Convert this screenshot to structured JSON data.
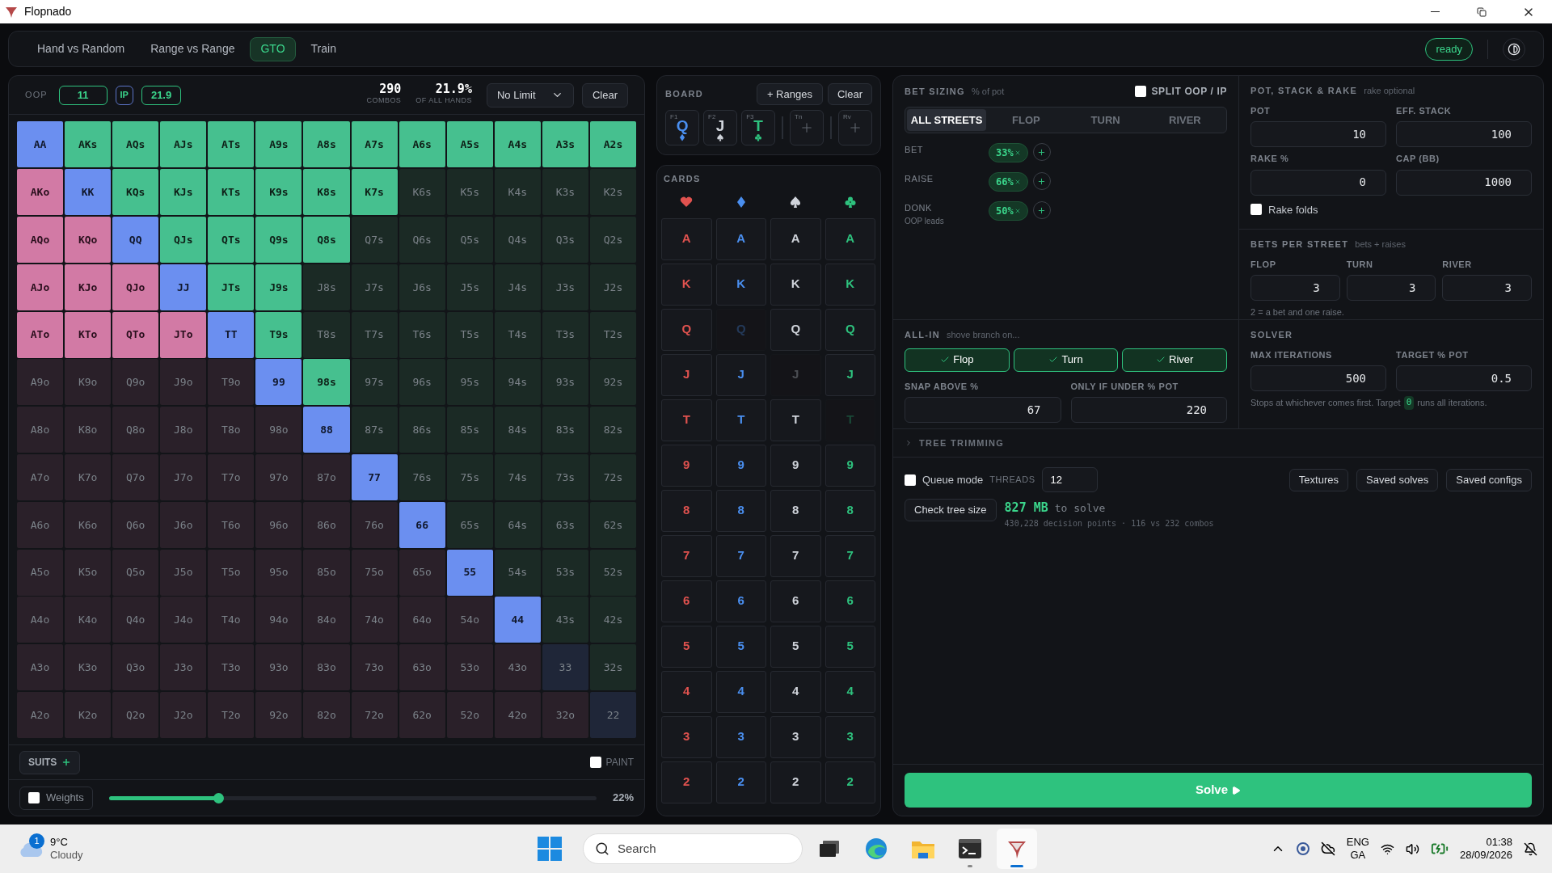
{
  "window": {
    "title": "Flopnado"
  },
  "nav": {
    "tabs": [
      {
        "label": "Hand vs Random",
        "selected": false
      },
      {
        "label": "Range vs Range",
        "selected": false
      },
      {
        "label": "GTO",
        "selected": true
      },
      {
        "label": "Train",
        "selected": false
      }
    ],
    "status": "ready"
  },
  "range": {
    "player_label": "OOP",
    "oop_value": "11",
    "ip_label": "IP",
    "ip_value": "21.9",
    "combos": "290",
    "combos_label": "COMBOS",
    "percent": "21.9%",
    "percent_label": "OF ALL HANDS",
    "limit_select": "No Limit",
    "clear": "Clear",
    "rows": [
      [
        {
          "label": "AA",
          "selected": true
        },
        {
          "label": "AKs",
          "selected": true
        },
        {
          "label": "AQs",
          "selected": true
        },
        {
          "label": "AJs",
          "selected": true
        },
        {
          "label": "ATs",
          "selected": true
        },
        {
          "label": "A9s",
          "selected": true
        },
        {
          "label": "A8s",
          "selected": true
        },
        {
          "label": "A7s",
          "selected": true
        },
        {
          "label": "A6s",
          "selected": true
        },
        {
          "label": "A5s",
          "selected": true
        },
        {
          "label": "A4s",
          "selected": true
        },
        {
          "label": "A3s",
          "selected": true
        },
        {
          "label": "A2s",
          "selected": true
        }
      ],
      [
        {
          "label": "AKo",
          "selected": true
        },
        {
          "label": "KK",
          "selected": true
        },
        {
          "label": "KQs",
          "selected": true
        },
        {
          "label": "KJs",
          "selected": true
        },
        {
          "label": "KTs",
          "selected": true
        },
        {
          "label": "K9s",
          "selected": true
        },
        {
          "label": "K8s",
          "selected": true
        },
        {
          "label": "K7s",
          "selected": true
        },
        {
          "label": "K6s",
          "selected": false
        },
        {
          "label": "K5s",
          "selected": false
        },
        {
          "label": "K4s",
          "selected": false
        },
        {
          "label": "K3s",
          "selected": false
        },
        {
          "label": "K2s",
          "selected": false
        }
      ],
      [
        {
          "label": "AQo",
          "selected": true
        },
        {
          "label": "KQo",
          "selected": true
        },
        {
          "label": "QQ",
          "selected": true
        },
        {
          "label": "QJs",
          "selected": true
        },
        {
          "label": "QTs",
          "selected": true
        },
        {
          "label": "Q9s",
          "selected": true
        },
        {
          "label": "Q8s",
          "selected": true
        },
        {
          "label": "Q7s",
          "selected": false
        },
        {
          "label": "Q6s",
          "selected": false
        },
        {
          "label": "Q5s",
          "selected": false
        },
        {
          "label": "Q4s",
          "selected": false
        },
        {
          "label": "Q3s",
          "selected": false
        },
        {
          "label": "Q2s",
          "selected": false
        }
      ],
      [
        {
          "label": "AJo",
          "selected": true
        },
        {
          "label": "KJo",
          "selected": true
        },
        {
          "label": "QJo",
          "selected": true
        },
        {
          "label": "JJ",
          "selected": true
        },
        {
          "label": "JTs",
          "selected": true
        },
        {
          "label": "J9s",
          "selected": true
        },
        {
          "label": "J8s",
          "selected": false
        },
        {
          "label": "J7s",
          "selected": false
        },
        {
          "label": "J6s",
          "selected": false
        },
        {
          "label": "J5s",
          "selected": false
        },
        {
          "label": "J4s",
          "selected": false
        },
        {
          "label": "J3s",
          "selected": false
        },
        {
          "label": "J2s",
          "selected": false
        }
      ],
      [
        {
          "label": "ATo",
          "selected": true
        },
        {
          "label": "KTo",
          "selected": true
        },
        {
          "label": "QTo",
          "selected": true
        },
        {
          "label": "JTo",
          "selected": true
        },
        {
          "label": "TT",
          "selected": true
        },
        {
          "label": "T9s",
          "selected": true
        },
        {
          "label": "T8s",
          "selected": false
        },
        {
          "label": "T7s",
          "selected": false
        },
        {
          "label": "T6s",
          "selected": false
        },
        {
          "label": "T5s",
          "selected": false
        },
        {
          "label": "T4s",
          "selected": false
        },
        {
          "label": "T3s",
          "selected": false
        },
        {
          "label": "T2s",
          "selected": false
        }
      ],
      [
        {
          "label": "A9o",
          "selected": false
        },
        {
          "label": "K9o",
          "selected": false
        },
        {
          "label": "Q9o",
          "selected": false
        },
        {
          "label": "J9o",
          "selected": false
        },
        {
          "label": "T9o",
          "selected": false
        },
        {
          "label": "99",
          "selected": true
        },
        {
          "label": "98s",
          "selected": true
        },
        {
          "label": "97s",
          "selected": false
        },
        {
          "label": "96s",
          "selected": false
        },
        {
          "label": "95s",
          "selected": false
        },
        {
          "label": "94s",
          "selected": false
        },
        {
          "label": "93s",
          "selected": false
        },
        {
          "label": "92s",
          "selected": false
        }
      ],
      [
        {
          "label": "A8o",
          "selected": false
        },
        {
          "label": "K8o",
          "selected": false
        },
        {
          "label": "Q8o",
          "selected": false
        },
        {
          "label": "J8o",
          "selected": false
        },
        {
          "label": "T8o",
          "selected": false
        },
        {
          "label": "98o",
          "selected": false
        },
        {
          "label": "88",
          "selected": true
        },
        {
          "label": "87s",
          "selected": false
        },
        {
          "label": "86s",
          "selected": false
        },
        {
          "label": "85s",
          "selected": false
        },
        {
          "label": "84s",
          "selected": false
        },
        {
          "label": "83s",
          "selected": false
        },
        {
          "label": "82s",
          "selected": false
        }
      ],
      [
        {
          "label": "A7o",
          "selected": false
        },
        {
          "label": "K7o",
          "selected": false
        },
        {
          "label": "Q7o",
          "selected": false
        },
        {
          "label": "J7o",
          "selected": false
        },
        {
          "label": "T7o",
          "selected": false
        },
        {
          "label": "97o",
          "selected": false
        },
        {
          "label": "87o",
          "selected": false
        },
        {
          "label": "77",
          "selected": true
        },
        {
          "label": "76s",
          "selected": false
        },
        {
          "label": "75s",
          "selected": false
        },
        {
          "label": "74s",
          "selected": false
        },
        {
          "label": "73s",
          "selected": false
        },
        {
          "label": "72s",
          "selected": false
        }
      ],
      [
        {
          "label": "A6o",
          "selected": false
        },
        {
          "label": "K6o",
          "selected": false
        },
        {
          "label": "Q6o",
          "selected": false
        },
        {
          "label": "J6o",
          "selected": false
        },
        {
          "label": "T6o",
          "selected": false
        },
        {
          "label": "96o",
          "selected": false
        },
        {
          "label": "86o",
          "selected": false
        },
        {
          "label": "76o",
          "selected": false
        },
        {
          "label": "66",
          "selected": true
        },
        {
          "label": "65s",
          "selected": false
        },
        {
          "label": "64s",
          "selected": false
        },
        {
          "label": "63s",
          "selected": false
        },
        {
          "label": "62s",
          "selected": false
        }
      ],
      [
        {
          "label": "A5o",
          "selected": false
        },
        {
          "label": "K5o",
          "selected": false
        },
        {
          "label": "Q5o",
          "selected": false
        },
        {
          "label": "J5o",
          "selected": false
        },
        {
          "label": "T5o",
          "selected": false
        },
        {
          "label": "95o",
          "selected": false
        },
        {
          "label": "85o",
          "selected": false
        },
        {
          "label": "75o",
          "selected": false
        },
        {
          "label": "65o",
          "selected": false
        },
        {
          "label": "55",
          "selected": true
        },
        {
          "label": "54s",
          "selected": false
        },
        {
          "label": "53s",
          "selected": false
        },
        {
          "label": "52s",
          "selected": false
        }
      ],
      [
        {
          "label": "A4o",
          "selected": false
        },
        {
          "label": "K4o",
          "selected": false
        },
        {
          "label": "Q4o",
          "selected": false
        },
        {
          "label": "J4o",
          "selected": false
        },
        {
          "label": "T4o",
          "selected": false
        },
        {
          "label": "94o",
          "selected": false
        },
        {
          "label": "84o",
          "selected": false
        },
        {
          "label": "74o",
          "selected": false
        },
        {
          "label": "64o",
          "selected": false
        },
        {
          "label": "54o",
          "selected": false
        },
        {
          "label": "44",
          "selected": true
        },
        {
          "label": "43s",
          "selected": false
        },
        {
          "label": "42s",
          "selected": false
        }
      ],
      [
        {
          "label": "A3o",
          "selected": false
        },
        {
          "label": "K3o",
          "selected": false
        },
        {
          "label": "Q3o",
          "selected": false
        },
        {
          "label": "J3o",
          "selected": false
        },
        {
          "label": "T3o",
          "selected": false
        },
        {
          "label": "93o",
          "selected": false
        },
        {
          "label": "83o",
          "selected": false
        },
        {
          "label": "73o",
          "selected": false
        },
        {
          "label": "63o",
          "selected": false
        },
        {
          "label": "53o",
          "selected": false
        },
        {
          "label": "43o",
          "selected": false
        },
        {
          "label": "33",
          "selected": false
        },
        {
          "label": "32s",
          "selected": false
        }
      ],
      [
        {
          "label": "A2o",
          "selected": false
        },
        {
          "label": "K2o",
          "selected": false
        },
        {
          "label": "Q2o",
          "selected": false
        },
        {
          "label": "J2o",
          "selected": false
        },
        {
          "label": "T2o",
          "selected": false
        },
        {
          "label": "92o",
          "selected": false
        },
        {
          "label": "82o",
          "selected": false
        },
        {
          "label": "72o",
          "selected": false
        },
        {
          "label": "62o",
          "selected": false
        },
        {
          "label": "52o",
          "selected": false
        },
        {
          "label": "42o",
          "selected": false
        },
        {
          "label": "32o",
          "selected": false
        },
        {
          "label": "22",
          "selected": false
        }
      ]
    ],
    "suits_button": "SUITS",
    "paint": {
      "label": "PAINT",
      "checked": false
    },
    "weights": {
      "label": "Weights",
      "checked": false
    },
    "slider": {
      "level": 0.225,
      "reading": "22%"
    }
  },
  "board": {
    "title": "BOARD",
    "ranges_button": "+ Ranges",
    "clear": "Clear",
    "cards": [
      {
        "slot": "F1",
        "rank": "Q",
        "kind": "diamond"
      },
      {
        "slot": "F2",
        "rank": "J",
        "kind": "spade"
      },
      {
        "slot": "F3",
        "rank": "T",
        "kind": "club"
      },
      {
        "slot": "Tn"
      },
      {
        "slot": "Rv"
      }
    ]
  },
  "cards": {
    "title": "CARDS",
    "columns": [
      {
        "kind": "heart"
      },
      {
        "kind": "diamond"
      },
      {
        "kind": "spade"
      },
      {
        "kind": "club"
      }
    ],
    "rows": [
      [
        {
          "rank": "A",
          "disabled": false
        },
        {
          "rank": "A",
          "disabled": false
        },
        {
          "rank": "A",
          "disabled": false
        },
        {
          "rank": "A",
          "disabled": false
        }
      ],
      [
        {
          "rank": "K",
          "disabled": false
        },
        {
          "rank": "K",
          "disabled": false
        },
        {
          "rank": "K",
          "disabled": false
        },
        {
          "rank": "K",
          "disabled": false
        }
      ],
      [
        {
          "rank": "Q",
          "disabled": false
        },
        {
          "rank": "Q",
          "disabled": true
        },
        {
          "rank": "Q",
          "disabled": false
        },
        {
          "rank": "Q",
          "disabled": false
        }
      ],
      [
        {
          "rank": "J",
          "disabled": false
        },
        {
          "rank": "J",
          "disabled": false
        },
        {
          "rank": "J",
          "disabled": true
        },
        {
          "rank": "J",
          "disabled": false
        }
      ],
      [
        {
          "rank": "T",
          "disabled": false
        },
        {
          "rank": "T",
          "disabled": false
        },
        {
          "rank": "T",
          "disabled": false
        },
        {
          "rank": "T",
          "disabled": true
        }
      ],
      [
        {
          "rank": "9",
          "disabled": false
        },
        {
          "rank": "9",
          "disabled": false
        },
        {
          "rank": "9",
          "disabled": false
        },
        {
          "rank": "9",
          "disabled": false
        }
      ],
      [
        {
          "rank": "8",
          "disabled": false
        },
        {
          "rank": "8",
          "disabled": false
        },
        {
          "rank": "8",
          "disabled": false
        },
        {
          "rank": "8",
          "disabled": false
        }
      ],
      [
        {
          "rank": "7",
          "disabled": false
        },
        {
          "rank": "7",
          "disabled": false
        },
        {
          "rank": "7",
          "disabled": false
        },
        {
          "rank": "7",
          "disabled": false
        }
      ],
      [
        {
          "rank": "6",
          "disabled": false
        },
        {
          "rank": "6",
          "disabled": false
        },
        {
          "rank": "6",
          "disabled": false
        },
        {
          "rank": "6",
          "disabled": false
        }
      ],
      [
        {
          "rank": "5",
          "disabled": false
        },
        {
          "rank": "5",
          "disabled": false
        },
        {
          "rank": "5",
          "disabled": false
        },
        {
          "rank": "5",
          "disabled": false
        }
      ],
      [
        {
          "rank": "4",
          "disabled": false
        },
        {
          "rank": "4",
          "disabled": false
        },
        {
          "rank": "4",
          "disabled": false
        },
        {
          "rank": "4",
          "disabled": false
        }
      ],
      [
        {
          "rank": "3",
          "disabled": false
        },
        {
          "rank": "3",
          "disabled": false
        },
        {
          "rank": "3",
          "disabled": false
        },
        {
          "rank": "3",
          "disabled": false
        }
      ],
      [
        {
          "rank": "2",
          "disabled": false
        },
        {
          "rank": "2",
          "disabled": false
        },
        {
          "rank": "2",
          "disabled": false
        },
        {
          "rank": "2",
          "disabled": false
        }
      ]
    ]
  },
  "bet_sizing": {
    "title": "BET SIZING",
    "subtitle": "% of pot",
    "split": {
      "label": "SPLIT OOP / IP",
      "checked": false
    },
    "tabs": [
      {
        "label": "ALL STREETS",
        "selected": true
      },
      {
        "label": "FLOP",
        "selected": false
      },
      {
        "label": "TURN",
        "selected": false
      },
      {
        "label": "RIVER",
        "selected": false
      }
    ],
    "rows": [
      {
        "label": "BET",
        "sizes": [
          "33%"
        ]
      },
      {
        "label": "RAISE",
        "sizes": [
          "66%"
        ]
      },
      {
        "label": "DONK",
        "note": "OOP leads",
        "sizes": [
          "50%"
        ]
      }
    ]
  },
  "pot_stack": {
    "title": "POT, STACK & RAKE",
    "subtitle": "rake optional",
    "fields": [
      {
        "label": "POT",
        "value": "10"
      },
      {
        "label": "EFF. STACK",
        "value": "100"
      },
      {
        "label": "RAKE %",
        "value": "0"
      },
      {
        "label": "CAP (BB)",
        "value": "1000"
      }
    ],
    "rake_folds": {
      "label": "Rake folds",
      "checked": false
    }
  },
  "bets_per_street": {
    "title": "BETS PER STREET",
    "subtitle": "bets + raises",
    "fields": [
      {
        "label": "FLOP",
        "value": "3"
      },
      {
        "label": "TURN",
        "value": "3"
      },
      {
        "label": "RIVER",
        "value": "3"
      }
    ],
    "hint": "2 = a bet and one raise."
  },
  "all_in": {
    "title": "ALL-IN",
    "subtitle": "shove branch on...",
    "streets": [
      {
        "label": "Flop",
        "checked": true
      },
      {
        "label": "Turn",
        "checked": true
      },
      {
        "label": "River",
        "checked": true
      }
    ],
    "fields": [
      {
        "label": "SNAP ABOVE %",
        "value": "67"
      },
      {
        "label": "ONLY IF UNDER % POT",
        "value": "220"
      }
    ]
  },
  "solver": {
    "title": "SOLVER",
    "fields": [
      {
        "label": "MAX ITERATIONS",
        "value": "500"
      },
      {
        "label": "TARGET % POT",
        "value": "0.5"
      }
    ],
    "hint_before": "Stops at whichever comes first. Target",
    "hint_code": "0",
    "hint_after": "runs all iterations."
  },
  "tree_trimming": {
    "title": "TREE TRIMMING",
    "expanded": false
  },
  "queue": {
    "label": "Queue mode",
    "checked": false
  },
  "threads": {
    "label": "THREADS",
    "value": "12"
  },
  "buttons": [
    "Textures",
    "Saved solves",
    "Saved configs"
  ],
  "tree_size": {
    "button": "Check tree size",
    "size": "827 MB",
    "suffix": "to solve",
    "details": "430,228 decision points · 116 vs 232 combos"
  },
  "solve_button": "Solve",
  "taskbar": {
    "weather": {
      "badge": "1",
      "temp": "9°C",
      "condition": "Cloudy"
    },
    "search": "Search",
    "apps": [
      {
        "kind": "taskview",
        "running": false,
        "active": false
      },
      {
        "kind": "browser",
        "running": false,
        "active": false
      },
      {
        "kind": "files",
        "running": false,
        "active": false
      },
      {
        "kind": "terminal",
        "running": true,
        "active": false
      },
      {
        "kind": "flopnado",
        "running": true,
        "active": true
      }
    ],
    "language": "ENG",
    "layout": "GA",
    "time": "01:38",
    "date": "28/09/2026"
  }
}
